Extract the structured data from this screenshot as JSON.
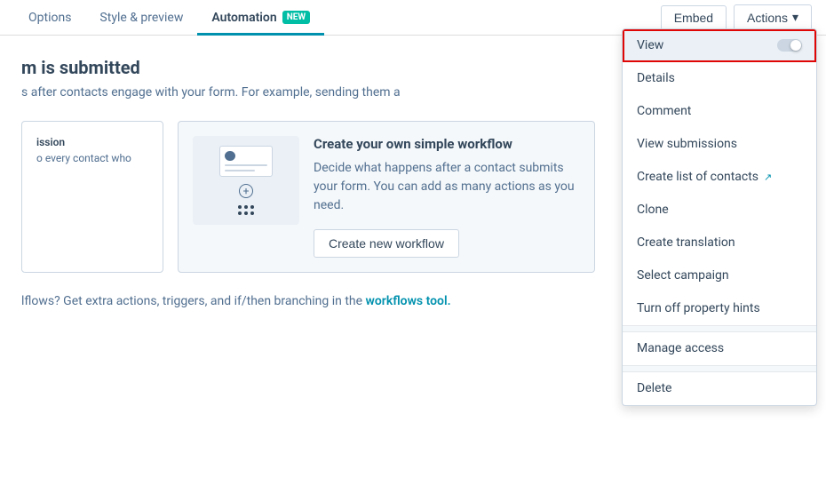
{
  "nav": {
    "tabs": [
      {
        "id": "options",
        "label": "Options",
        "active": false
      },
      {
        "id": "style-preview",
        "label": "Style & preview",
        "active": false
      },
      {
        "id": "automation",
        "label": "Automation",
        "active": true,
        "badge": "NEW"
      }
    ],
    "embed_label": "Embed",
    "actions_label": "Actions",
    "actions_chevron": "▾"
  },
  "main": {
    "title": "m is submitted",
    "subtitle": "s after contacts engage with your form. For example, sending them a",
    "cards": [
      {
        "id": "submission",
        "title": "ission",
        "desc": "o every contact who"
      }
    ],
    "workflow_card": {
      "title": "Create your own simple workflow",
      "desc": "Decide what happens after a contact submits your form. You can add as many actions as you need.",
      "btn_label": "Create new workflow"
    },
    "bottom_text": "lflows? Get extra actions, triggers, and if/then branching in the",
    "bottom_link": "workflows tool."
  },
  "dropdown": {
    "items": [
      {
        "id": "view",
        "label": "View",
        "active": true,
        "has_toggle": true
      },
      {
        "id": "details",
        "label": "Details"
      },
      {
        "id": "comment",
        "label": "Comment"
      },
      {
        "id": "view-submissions",
        "label": "View submissions"
      },
      {
        "id": "create-list",
        "label": "Create list of contacts",
        "external": true
      },
      {
        "id": "clone",
        "label": "Clone"
      },
      {
        "id": "create-translation",
        "label": "Create translation"
      },
      {
        "id": "select-campaign",
        "label": "Select campaign"
      },
      {
        "id": "turn-off-hints",
        "label": "Turn off property hints"
      },
      {
        "id": "divider1"
      },
      {
        "id": "manage-access",
        "label": "Manage access",
        "section": true
      },
      {
        "id": "divider2"
      },
      {
        "id": "delete",
        "label": "Delete"
      }
    ]
  }
}
